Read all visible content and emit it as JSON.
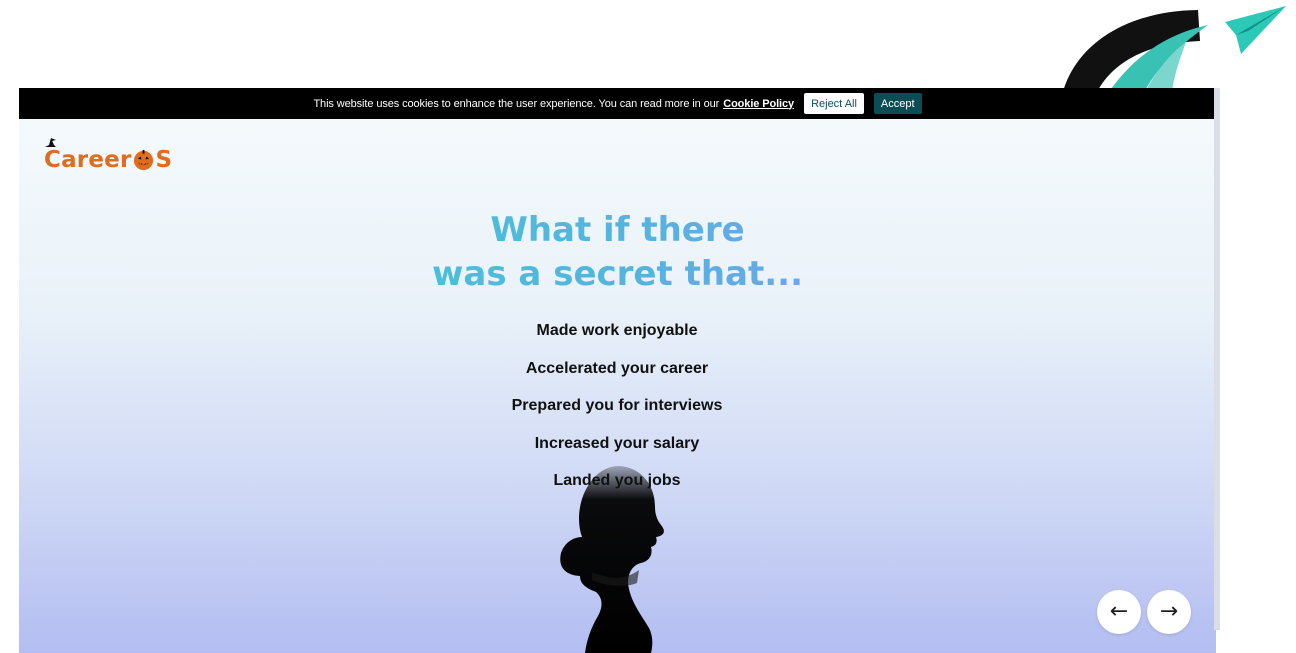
{
  "cookie_banner": {
    "message": "This website uses cookies to enhance the user experience. You can read more in our",
    "policy_link": "Cookie Policy",
    "reject_label": "Reject All",
    "accept_label": "Accept"
  },
  "brand": {
    "text_left": "Career",
    "text_right": "S",
    "pumpkin_icon": "jack-o-lantern-icon",
    "hat_icon": "witch-hat-icon",
    "color": "#e06d1f"
  },
  "hero": {
    "title_line1": "What if there",
    "title_line2": "was a secret that...",
    "title_color": "#52bfdc",
    "benefits": [
      "Made work enjoyable",
      "Accelerated your career",
      "Prepared you for interviews",
      "Increased your salary",
      "Landed you jobs"
    ]
  },
  "carousel": {
    "prev_icon": "←",
    "next_icon": "→",
    "prev_icon_name": "arrow-left-icon",
    "next_icon_name": "arrow-right-icon"
  },
  "colors": {
    "cookie_bar": "#000000",
    "accept_button": "#0b4d55",
    "hero_gradient_top": "#f6fbfd",
    "hero_gradient_bottom": "#b3bdf1",
    "logo_teal": "#39c2b3",
    "logo_dark": "#111111"
  }
}
